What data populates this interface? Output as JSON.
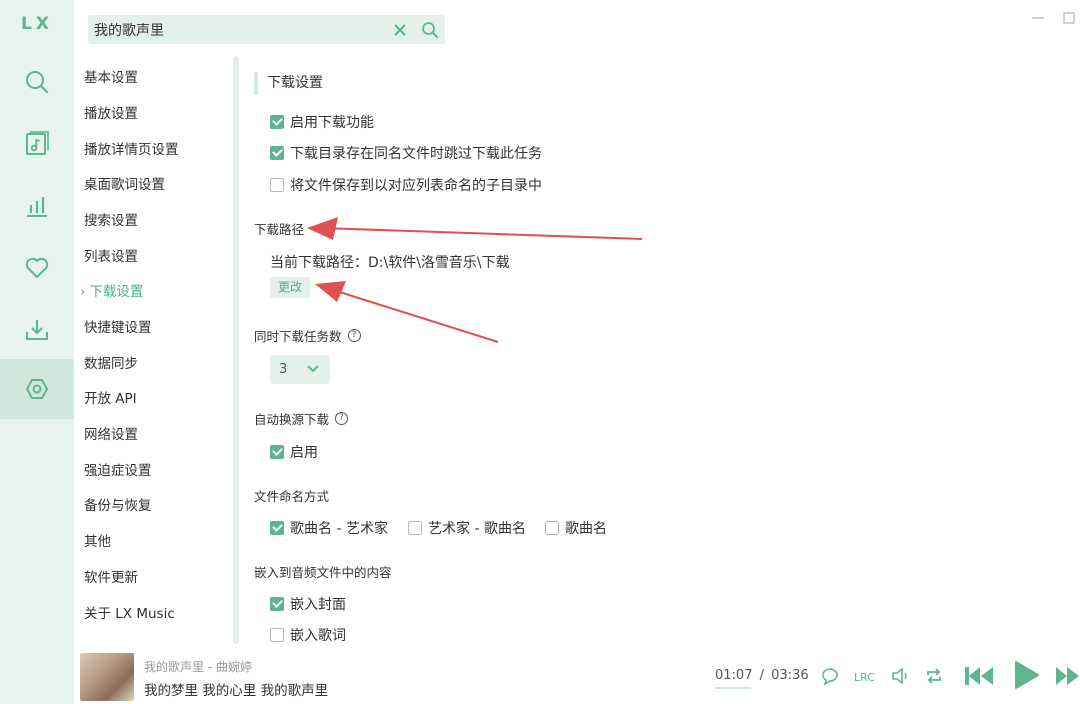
{
  "app": {
    "logo": "LX"
  },
  "search": {
    "value": "我的歌声里"
  },
  "nav": {
    "items": [
      "基本设置",
      "播放设置",
      "播放详情页设置",
      "桌面歌词设置",
      "搜索设置",
      "列表设置",
      "下载设置",
      "快捷键设置",
      "数据同步",
      "开放 API",
      "网络设置",
      "强迫症设置",
      "备份与恢复",
      "其他",
      "软件更新",
      "关于 LX Music"
    ],
    "active_marker": "›"
  },
  "download": {
    "section_title": "下载设置",
    "enable_label": "启用下载功能",
    "skip_label": "下载目录存在同名文件时跳过下载此任务",
    "subdir_label": "将文件保存到以对应列表命名的子目录中",
    "path_title": "下载路径",
    "current_path": "当前下载路径：D:\\软件\\洛雪音乐\\下载",
    "change_label": "更改",
    "concurrent_title": "同时下载任务数",
    "concurrent_value": "3",
    "auto_switch_title": "自动换源下载",
    "auto_switch_enable": "启用",
    "naming_title": "文件命名方式",
    "naming_options": [
      "歌曲名 - 艺术家",
      "艺术家 - 歌曲名",
      "歌曲名"
    ],
    "embed_title": "嵌入到音频文件中的内容",
    "embed_cover": "嵌入封面",
    "embed_lyrics": "嵌入歌词"
  },
  "player": {
    "title": "我的歌声里 - 曲婉婷",
    "lyric": "我的梦里 我的心里 我的歌声里",
    "current_time": "01:07",
    "separator": "/",
    "total_time": "03:36",
    "progress": 0.31
  },
  "colors": {
    "accent": "#5fb590",
    "accent_text": "#4cae84",
    "rail_bg": "#e6f3ee",
    "arrow": "#e05050"
  }
}
